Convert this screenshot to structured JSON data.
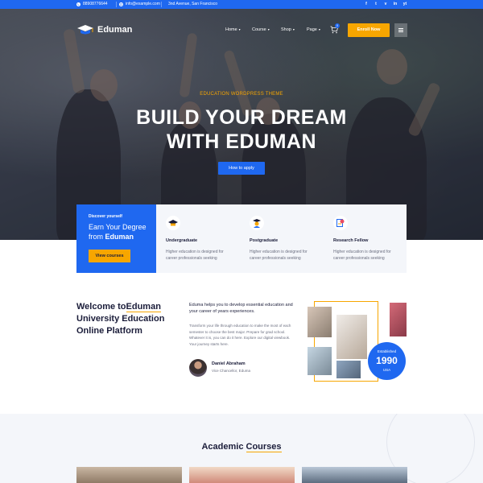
{
  "topbar": {
    "phone": "88908776644",
    "email": "info@example.com",
    "address": "3nd Avenue, San Francisco",
    "social": [
      "f",
      "t",
      "v",
      "in",
      "yt"
    ]
  },
  "header": {
    "logo_text": "Eduman",
    "nav": [
      "Home",
      "Course",
      "Shop",
      "Page"
    ],
    "cart_count": "0",
    "enroll_label": "Enroll Now"
  },
  "hero": {
    "subtitle": "EDUCATION WORDPRESS THEME",
    "title_line1": "BUILD YOUR DREAM",
    "title_line2": "WITH EDUMAN",
    "button_label": "How to apply"
  },
  "discover": {
    "small": "Discover yourself",
    "line1": "Earn Your Degree",
    "line2_prefix": "from ",
    "line2_brand": "Eduman",
    "button_label": "View courses"
  },
  "features": [
    {
      "title": "Undergraduate",
      "desc_line1": "Higher education is designed for",
      "desc_line2": "career professionals seeking",
      "icon": "graduation-cap-icon"
    },
    {
      "title": "Postgraduate",
      "desc_line1": "Higher education is designed for",
      "desc_line2": "career professionals seeking",
      "icon": "scholar-icon"
    },
    {
      "title": "Research Fellow",
      "desc_line1": "Higher education is designed for",
      "desc_line2": "career professionals seeking",
      "icon": "research-icon"
    }
  ],
  "welcome": {
    "title_prefix": "Welcome to",
    "title_brand": "Eduman",
    "title_line2": "University Education",
    "title_line3": "Online Platform",
    "intro": "Eduma helps you to develop essential education and your career of years experiences.",
    "body": "Transform your life through education to make the most of each semester to choose the best major. Prepare for grad school. Whatever it is, you can do it here. Explore our digital viewbook. Your journey starts here.",
    "author_name": "Daniel Abraham",
    "author_role": "Vice Chancellor, Eduma"
  },
  "established": {
    "label": "Established",
    "year": "1990",
    "country": "USA"
  },
  "academic": {
    "title_prefix": "Academic ",
    "title_highlight": "Courses"
  },
  "colors": {
    "primary": "#1f68f0",
    "accent": "#f7a600",
    "dark": "#1b1d3a"
  }
}
